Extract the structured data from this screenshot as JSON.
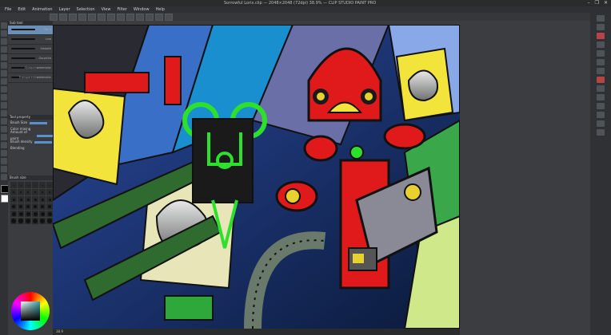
{
  "window": {
    "title": "Sorrowful Lorix.clip — 2048×2048 (72dpi) 38.9% — CLIP STUDIO PAINT PRO",
    "controls": [
      "–",
      "❐",
      "✕"
    ]
  },
  "menu": [
    "File",
    "Edit",
    "Animation",
    "Layer",
    "Selection",
    "View",
    "Filter",
    "Window",
    "Help"
  ],
  "brush_panel": {
    "header": "Sub tool",
    "brushes": [
      {
        "label": "Paint"
      },
      {
        "label": "Line"
      },
      {
        "label": "Smooth"
      },
      {
        "label": "Gouache"
      },
      {
        "label": "Opaque watercolor"
      },
      {
        "label": "Transparent watercolor"
      }
    ]
  },
  "tool_property": {
    "header": "Tool property",
    "rows": [
      "Brush Size",
      "Color mixing",
      "Amount of paint",
      "Brush density",
      "Blending"
    ]
  },
  "brush_size_panel": {
    "header": "Brush size"
  },
  "status": "38.9"
}
